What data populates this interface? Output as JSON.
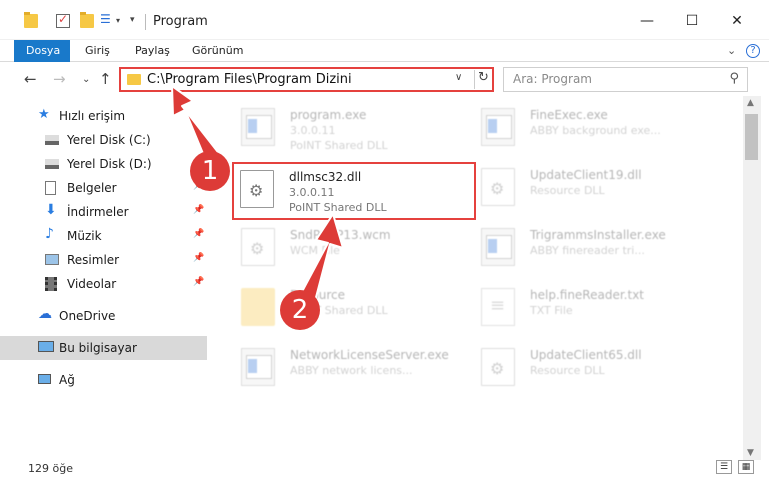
{
  "window": {
    "title": "Program",
    "min_glyph": "—",
    "max_glyph": "☐",
    "close_glyph": "✕"
  },
  "ribbon": {
    "tabs": [
      "Dosya",
      "Giriş",
      "Paylaş",
      "Görünüm"
    ],
    "active_tab": "Dosya",
    "expand_glyph": "⌄",
    "help_glyph": "?"
  },
  "address": {
    "path": "C:\\Program Files\\Program Dizini",
    "dropdown_glyph": "∨",
    "refresh_glyph": "↻",
    "back_glyph": "←",
    "forward_glyph": "→",
    "recent_glyph": "⌄",
    "up_glyph": "↑"
  },
  "search": {
    "placeholder": "Ara: Program",
    "icon_glyph": "⚲"
  },
  "sidebar": {
    "items": [
      {
        "label": "Hızlı erişim",
        "icon": "star-icon",
        "pinned": false
      },
      {
        "label": "Yerel Disk (C:)",
        "icon": "drive-icon",
        "pinned": false
      },
      {
        "label": "Yerel Disk (D:)",
        "icon": "drive-icon",
        "pinned": false
      },
      {
        "label": "Belgeler",
        "icon": "documents-icon",
        "pinned": true
      },
      {
        "label": "İndirmeler",
        "icon": "download-icon",
        "pinned": true
      },
      {
        "label": "Müzik",
        "icon": "music-icon",
        "pinned": true
      },
      {
        "label": "Resimler",
        "icon": "pictures-icon",
        "pinned": true
      },
      {
        "label": "Videolar",
        "icon": "videos-icon",
        "pinned": true
      },
      {
        "label": "OneDrive",
        "icon": "cloud-icon",
        "pinned": false
      },
      {
        "label": "Bu bilgisayar",
        "icon": "computer-icon",
        "pinned": false
      },
      {
        "label": "Ağ",
        "icon": "network-icon",
        "pinned": false
      }
    ],
    "pin_glyph": "📌",
    "selected": "Bu bilgisayar"
  },
  "files": {
    "left": [
      {
        "name": "program.exe",
        "line1": "3.0.0.11",
        "line2": "PoINT Shared DLL",
        "icon": "exe-icon"
      },
      {
        "name": "dllmsc32.dll",
        "line1": "3.0.0.11",
        "line2": "PoINT Shared DLL",
        "icon": "dll-gear-icon"
      },
      {
        "name": "SndPSAP13.wcm",
        "line1": "WCM File",
        "line2": "",
        "icon": "dll-gear-icon"
      },
      {
        "name": "Resource",
        "line1": "",
        "line2": "PoINT Shared DLL",
        "icon": "folder-icon"
      },
      {
        "name": "NetworkLicenseServer.exe",
        "line1": "ABBY network licens...",
        "line2": "",
        "icon": "exe-icon"
      }
    ],
    "right": [
      {
        "name": "FineExec.exe",
        "line1": "ABBY background exe...",
        "line2": "",
        "icon": "exe-icon"
      },
      {
        "name": "UpdateClient19.dll",
        "line1": "Resource DLL",
        "line2": "",
        "icon": "dll-gear-icon"
      },
      {
        "name": "TrigrammsInstaller.exe",
        "line1": "ABBY finereader tri...",
        "line2": "",
        "icon": "exe-icon"
      },
      {
        "name": "help.fineReader.txt",
        "line1": "TXT File",
        "line2": "",
        "icon": "txt-icon"
      },
      {
        "name": "UpdateClient65.dll",
        "line1": "Resource DLL",
        "line2": "",
        "icon": "dll-gear-icon"
      }
    ],
    "highlighted": "dllmsc32.dll"
  },
  "status": {
    "item_count": "129 öğe"
  },
  "callouts": {
    "step1": "1",
    "step2": "2",
    "color": "#dd3b37"
  }
}
